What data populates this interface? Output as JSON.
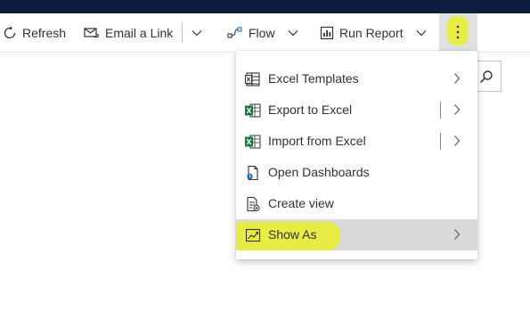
{
  "commandbar": {
    "refresh_label": "Refresh",
    "email_label": "Email a Link",
    "flow_label": "Flow",
    "run_report_label": "Run Report"
  },
  "menu": {
    "items": [
      {
        "label": "Excel Templates",
        "icon": "excel-templates-icon",
        "has_submenu": true,
        "split": false
      },
      {
        "label": "Export to Excel",
        "icon": "excel-export-icon",
        "has_submenu": true,
        "split": true
      },
      {
        "label": "Import from Excel",
        "icon": "excel-import-icon",
        "has_submenu": true,
        "split": true
      },
      {
        "label": "Open Dashboards",
        "icon": "dashboard-icon",
        "has_submenu": false,
        "split": false
      },
      {
        "label": "Create view",
        "icon": "create-view-icon",
        "has_submenu": false,
        "split": false
      },
      {
        "label": "Show As",
        "icon": "chart-icon",
        "has_submenu": true,
        "split": false,
        "selected": true
      }
    ]
  },
  "colors": {
    "topbar": "#0b1e3d",
    "highlight": "#e9ee3b",
    "excel_green": "#107c41",
    "selected_bg": "#d9d9d9"
  }
}
